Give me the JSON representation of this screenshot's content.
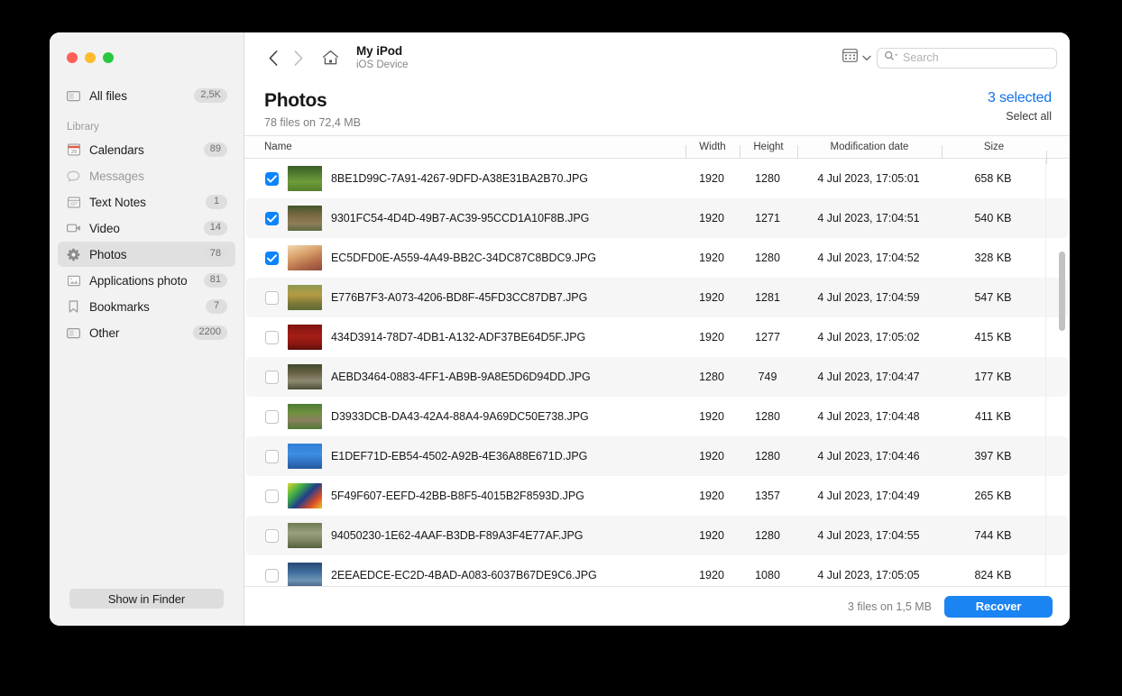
{
  "window": {
    "traffic_lights": [
      "close",
      "minimize",
      "zoom"
    ],
    "colors": {
      "accent": "#1273e6",
      "recover_button": "#1a84f2",
      "checkbox_on": "#0a84ff"
    }
  },
  "sidebar": {
    "all_files": {
      "label": "All files",
      "badge": "2,5K",
      "icon": "folder-icon"
    },
    "section_label": "Library",
    "items": [
      {
        "label": "Calendars",
        "badge": "89",
        "icon": "calendar-icon",
        "active": false,
        "dim": false
      },
      {
        "label": "Messages",
        "badge": "",
        "icon": "message-icon",
        "active": false,
        "dim": true
      },
      {
        "label": "Text Notes",
        "badge": "1",
        "icon": "notes-icon",
        "active": false,
        "dim": false
      },
      {
        "label": "Video",
        "badge": "14",
        "icon": "video-icon",
        "active": false,
        "dim": false
      },
      {
        "label": "Photos",
        "badge": "78",
        "icon": "photos-icon",
        "active": true,
        "dim": false
      },
      {
        "label": "Applications photo",
        "badge": "81",
        "icon": "appphoto-icon",
        "active": false,
        "dim": false
      },
      {
        "label": "Bookmarks",
        "badge": "7",
        "icon": "bookmark-icon",
        "active": false,
        "dim": false
      },
      {
        "label": "Other",
        "badge": "2200",
        "icon": "folder-icon",
        "active": false,
        "dim": false
      }
    ],
    "show_in_finder": "Show in Finder"
  },
  "toolbar": {
    "back_icon": "chevron-left-icon",
    "forward_icon": "chevron-right-icon",
    "home_icon": "home-icon",
    "device_name": "My iPod",
    "device_subtitle": "iOS Device",
    "view_icon": "grid-view-icon",
    "view_chevron": "chevron-down-icon",
    "search_icon": "search-icon",
    "search_value": "",
    "search_placeholder": "Search"
  },
  "page": {
    "title": "Photos",
    "subtitle": "78 files on 72,4 MB",
    "selected_count": "3 selected",
    "select_all": "Select all"
  },
  "table": {
    "columns": [
      "Name",
      "Width",
      "Height",
      "Modification date",
      "Size"
    ],
    "rows": [
      {
        "checked": true,
        "name": "8BE1D99C-7A91-4267-9DFD-A38E31BA2B70.JPG",
        "width": "1920",
        "height": "1280",
        "date": "4 Jul 2023, 17:05:01",
        "size": "658 KB",
        "thumb": "sheep-grass"
      },
      {
        "checked": true,
        "name": "9301FC54-4D4D-49B7-AC39-95CCD1A10F8B.JPG",
        "width": "1920",
        "height": "1271",
        "date": "4 Jul 2023, 17:04:51",
        "size": "540 KB",
        "thumb": "dog-path"
      },
      {
        "checked": true,
        "name": "EC5DFD0E-A559-4A49-BB2C-34DC87C8BDC9.JPG",
        "width": "1920",
        "height": "1280",
        "date": "4 Jul 2023, 17:04:52",
        "size": "328 KB",
        "thumb": "puppy-warm"
      },
      {
        "checked": false,
        "name": "E776B7F3-A073-4206-BD8F-45FD3CC87DB7.JPG",
        "width": "1920",
        "height": "1281",
        "date": "4 Jul 2023, 17:04:59",
        "size": "547 KB",
        "thumb": "duckling-water"
      },
      {
        "checked": false,
        "name": "434D3914-78D7-4DB1-A132-ADF37BE64D5F.JPG",
        "width": "1920",
        "height": "1277",
        "date": "4 Jul 2023, 17:05:02",
        "size": "415 KB",
        "thumb": "bird-red"
      },
      {
        "checked": false,
        "name": "AEBD3464-0883-4FF1-AB9B-9A8E5D6D94DD.JPG",
        "width": "1280",
        "height": "749",
        "date": "4 Jul 2023, 17:04:47",
        "size": "177 KB",
        "thumb": "stream-rock"
      },
      {
        "checked": false,
        "name": "D3933DCB-DA43-42A4-88A4-9A69DC50E738.JPG",
        "width": "1920",
        "height": "1280",
        "date": "4 Jul 2023, 17:04:48",
        "size": "411 KB",
        "thumb": "hedgehog-green"
      },
      {
        "checked": false,
        "name": "E1DEF71D-EB54-4502-A92B-4E36A88E671D.JPG",
        "width": "1920",
        "height": "1280",
        "date": "4 Jul 2023, 17:04:46",
        "size": "397 KB",
        "thumb": "bird-blue"
      },
      {
        "checked": false,
        "name": "5F49F607-EEFD-42BB-B8F5-4015B2F8593D.JPG",
        "width": "1920",
        "height": "1357",
        "date": "4 Jul 2023, 17:04:49",
        "size": "265 KB",
        "thumb": "colorful-lens"
      },
      {
        "checked": false,
        "name": "94050230-1E62-4AAF-B3DB-F89A3F4E77AF.JPG",
        "width": "1920",
        "height": "1280",
        "date": "4 Jul 2023, 17:04:55",
        "size": "744 KB",
        "thumb": "cat-grass"
      },
      {
        "checked": false,
        "name": "2EEAEDCE-EC2D-4BAD-A083-6037B67DE9C6.JPG",
        "width": "1920",
        "height": "1080",
        "date": "4 Jul 2023, 17:05:05",
        "size": "824 KB",
        "thumb": "city-blue"
      }
    ]
  },
  "footer": {
    "info": "3 files on 1,5 MB",
    "recover_label": "Recover"
  }
}
